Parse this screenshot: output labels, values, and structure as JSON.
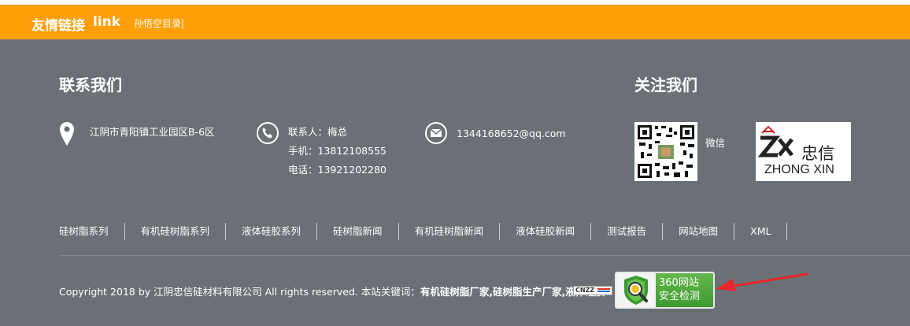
{
  "links_bar": {
    "title": "友情链接",
    "subtitle": "link",
    "items": [
      "孙悟空目录|"
    ]
  },
  "contact": {
    "heading": "联系我们",
    "address": "江阴市青阳镇工业园区B-6区",
    "person": "联系人：梅总",
    "mobile": "手机：13812108555",
    "phone": "电话：13921202280",
    "email": "1344168652@qq.com"
  },
  "follow": {
    "heading": "关注我们",
    "wechat_label": "微信",
    "logo_text_cn": "忠信",
    "logo_text_en": "ZHONG XIN"
  },
  "nav": [
    "硅树脂系列",
    "有机硅树脂系列",
    "液体硅胶系列",
    "硅树脂新闻",
    "有机硅树脂新闻",
    "液体硅胶新闻",
    "测试报告",
    "网站地图",
    "XML"
  ],
  "footer": {
    "copyright": "Copyright 2018 by 江阴忠信硅材料有限公司 All rights reserved. 本站关键词：",
    "keywords": "有机硅树脂厂家,硅树脂生产厂家,液体硅胶",
    "cnzz_label": "CNZZ",
    "badge_line1": "360网站",
    "badge_line2": "安全检测"
  },
  "colors": {
    "links_bar": "#ff9f0a",
    "background": "#6a7076",
    "badge_green": "#4caf3a",
    "arrow_red": "#e8262b"
  },
  "icons": [
    "location-pin-icon",
    "phone-icon",
    "mail-icon",
    "shield-magnifier-icon"
  ]
}
